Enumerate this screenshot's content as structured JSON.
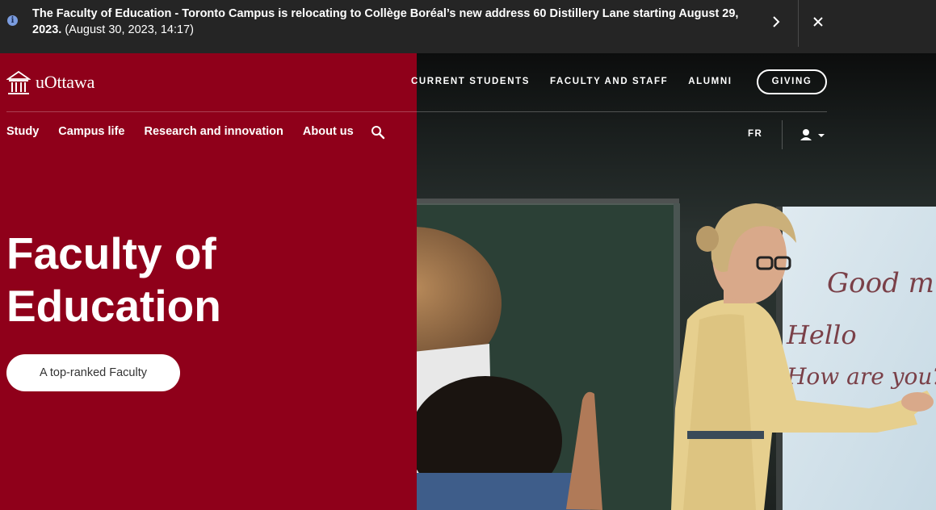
{
  "alert": {
    "message": "The Faculty of Education - Toronto Campus is relocating to Collège Boréal’s new address 60 Distillery Lane starting August 29, 2023.",
    "timestamp": "(August 30, 2023, 14:17)"
  },
  "header": {
    "logo_text": "uOttawa",
    "top_links": [
      "CURRENT STUDENTS",
      "FACULTY AND STAFF",
      "ALUMNI"
    ],
    "giving": "GIVING",
    "main_nav": [
      "Study",
      "Campus life",
      "Research and innovation",
      "About us"
    ],
    "language": "FR"
  },
  "hero": {
    "title_line1": "Faculty of",
    "title_line2": "Education",
    "badge": "A top-ranked Faculty"
  },
  "colors": {
    "brand_red": "#8f001a",
    "banner_bg": "#252525"
  },
  "photo": {
    "board_text": [
      "Good m",
      "Hello",
      "How are you?"
    ]
  }
}
